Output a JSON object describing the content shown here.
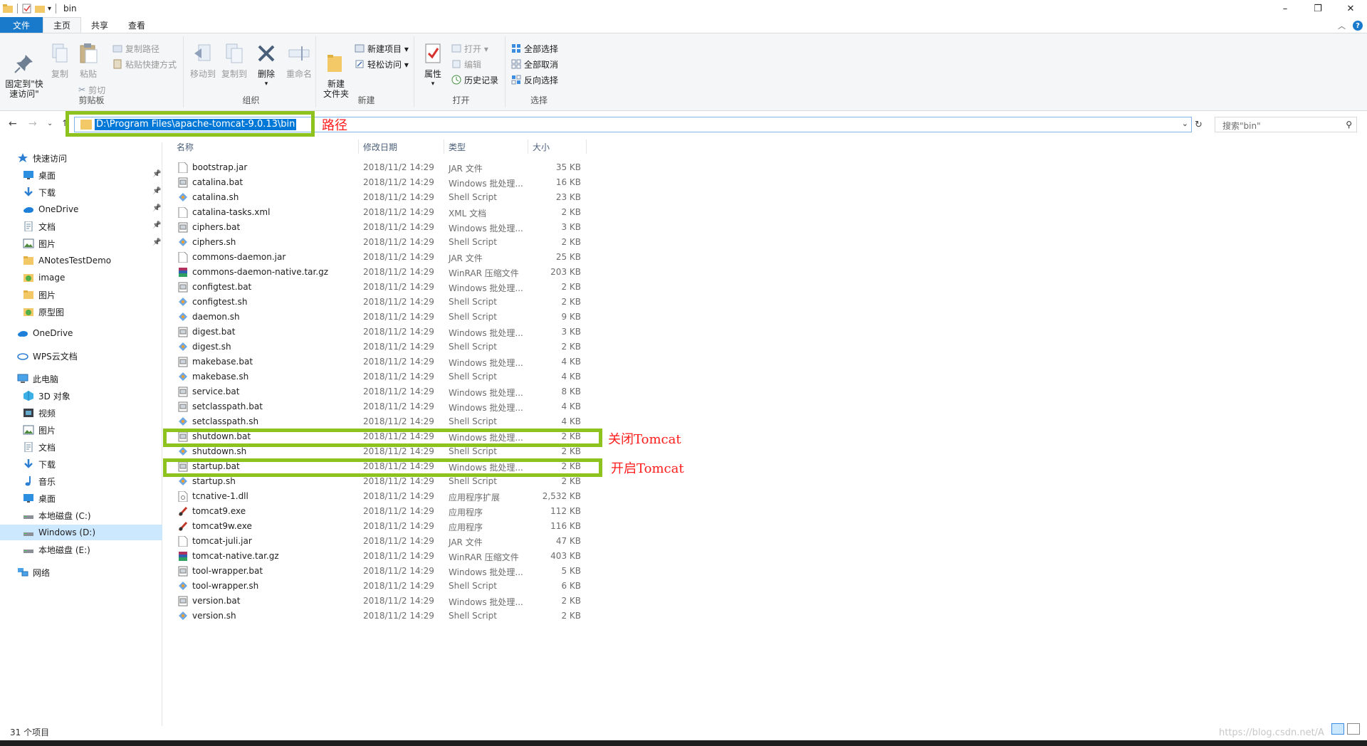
{
  "window": {
    "title": "bin",
    "controls": [
      "–",
      "❐",
      "✕"
    ]
  },
  "ribbon_tabs": [
    "文件",
    "主页",
    "共享",
    "查看"
  ],
  "ribbon": {
    "clipboard": {
      "label": "剪贴板",
      "pin": "固定到\"快\n速访问\"",
      "copy": "复制",
      "paste": "粘贴",
      "copy_path": "复制路径",
      "paste_shortcut": "粘贴快捷方式",
      "cut": "剪切"
    },
    "organize": {
      "label": "组织",
      "move_to": "移动到",
      "copy_to": "复制到",
      "delete": "删除",
      "rename": "重命名"
    },
    "new": {
      "label": "新建",
      "new_folder": "新建\n文件夹",
      "new_item": "新建项目 ▾",
      "easy_access": "轻松访问 ▾"
    },
    "open": {
      "label": "打开",
      "properties": "属性",
      "open": "打开 ▾",
      "edit": "编辑",
      "history": "历史记录"
    },
    "select": {
      "label": "选择",
      "select_all": "全部选择",
      "select_none": "全部取消",
      "invert": "反向选择"
    }
  },
  "address": {
    "path": "D:\\Program Files\\apache-tomcat-9.0.13\\bin",
    "search_placeholder": "搜索\"bin\""
  },
  "annotations": {
    "path": "路径",
    "shutdown": "关闭Tomcat",
    "startup": "开启Tomcat"
  },
  "nav_pane": [
    {
      "label": "快速访问",
      "icon": "star-icon",
      "level": 0
    },
    {
      "label": "桌面",
      "icon": "desktop-icon",
      "level": 1,
      "pinned": true
    },
    {
      "label": "下载",
      "icon": "download-icon",
      "level": 1,
      "pinned": true
    },
    {
      "label": "OneDrive",
      "icon": "cloud-icon",
      "level": 1,
      "pinned": true
    },
    {
      "label": "文档",
      "icon": "document-icon",
      "level": 1,
      "pinned": true
    },
    {
      "label": "图片",
      "icon": "picture-icon",
      "level": 1,
      "pinned": true
    },
    {
      "label": "ANotesTestDemo",
      "icon": "folder-icon",
      "level": 1
    },
    {
      "label": "image",
      "icon": "folder-image-icon",
      "level": 1
    },
    {
      "label": "图片",
      "icon": "folder-icon",
      "level": 1
    },
    {
      "label": "原型图",
      "icon": "folder-image-icon",
      "level": 1
    },
    {
      "label": "OneDrive",
      "icon": "cloud-icon",
      "level": 0
    },
    {
      "label": "WPS云文档",
      "icon": "wps-cloud-icon",
      "level": 0
    },
    {
      "label": "此电脑",
      "icon": "pc-icon",
      "level": 0
    },
    {
      "label": "3D 对象",
      "icon": "3d-icon",
      "level": 1
    },
    {
      "label": "视频",
      "icon": "video-icon",
      "level": 1
    },
    {
      "label": "图片",
      "icon": "picture-icon",
      "level": 1
    },
    {
      "label": "文档",
      "icon": "document-icon",
      "level": 1
    },
    {
      "label": "下载",
      "icon": "download-icon",
      "level": 1
    },
    {
      "label": "音乐",
      "icon": "music-icon",
      "level": 1
    },
    {
      "label": "桌面",
      "icon": "desktop-icon",
      "level": 1
    },
    {
      "label": "本地磁盘 (C:)",
      "icon": "drive-icon",
      "level": 1
    },
    {
      "label": "Windows (D:)",
      "icon": "drive-icon",
      "level": 1,
      "selected": true
    },
    {
      "label": "本地磁盘 (E:)",
      "icon": "drive-icon",
      "level": 1
    },
    {
      "label": "网络",
      "icon": "network-icon",
      "level": 0
    }
  ],
  "columns": [
    "名称",
    "修改日期",
    "类型",
    "大小"
  ],
  "files": [
    {
      "name": "bootstrap.jar",
      "date": "2018/11/2 14:29",
      "type": "JAR 文件",
      "size": "35 KB",
      "icon": "jar"
    },
    {
      "name": "catalina.bat",
      "date": "2018/11/2 14:29",
      "type": "Windows 批处理...",
      "size": "16 KB",
      "icon": "bat"
    },
    {
      "name": "catalina.sh",
      "date": "2018/11/2 14:29",
      "type": "Shell Script",
      "size": "23 KB",
      "icon": "sh"
    },
    {
      "name": "catalina-tasks.xml",
      "date": "2018/11/2 14:29",
      "type": "XML 文档",
      "size": "2 KB",
      "icon": "jar"
    },
    {
      "name": "ciphers.bat",
      "date": "2018/11/2 14:29",
      "type": "Windows 批处理...",
      "size": "3 KB",
      "icon": "bat"
    },
    {
      "name": "ciphers.sh",
      "date": "2018/11/2 14:29",
      "type": "Shell Script",
      "size": "2 KB",
      "icon": "sh"
    },
    {
      "name": "commons-daemon.jar",
      "date": "2018/11/2 14:29",
      "type": "JAR 文件",
      "size": "25 KB",
      "icon": "jar"
    },
    {
      "name": "commons-daemon-native.tar.gz",
      "date": "2018/11/2 14:29",
      "type": "WinRAR 压缩文件",
      "size": "203 KB",
      "icon": "rar"
    },
    {
      "name": "configtest.bat",
      "date": "2018/11/2 14:29",
      "type": "Windows 批处理...",
      "size": "2 KB",
      "icon": "bat"
    },
    {
      "name": "configtest.sh",
      "date": "2018/11/2 14:29",
      "type": "Shell Script",
      "size": "2 KB",
      "icon": "sh"
    },
    {
      "name": "daemon.sh",
      "date": "2018/11/2 14:29",
      "type": "Shell Script",
      "size": "9 KB",
      "icon": "sh"
    },
    {
      "name": "digest.bat",
      "date": "2018/11/2 14:29",
      "type": "Windows 批处理...",
      "size": "3 KB",
      "icon": "bat"
    },
    {
      "name": "digest.sh",
      "date": "2018/11/2 14:29",
      "type": "Shell Script",
      "size": "2 KB",
      "icon": "sh"
    },
    {
      "name": "makebase.bat",
      "date": "2018/11/2 14:29",
      "type": "Windows 批处理...",
      "size": "4 KB",
      "icon": "bat"
    },
    {
      "name": "makebase.sh",
      "date": "2018/11/2 14:29",
      "type": "Shell Script",
      "size": "4 KB",
      "icon": "sh"
    },
    {
      "name": "service.bat",
      "date": "2018/11/2 14:29",
      "type": "Windows 批处理...",
      "size": "8 KB",
      "icon": "bat"
    },
    {
      "name": "setclasspath.bat",
      "date": "2018/11/2 14:29",
      "type": "Windows 批处理...",
      "size": "4 KB",
      "icon": "bat"
    },
    {
      "name": "setclasspath.sh",
      "date": "2018/11/2 14:29",
      "type": "Shell Script",
      "size": "4 KB",
      "icon": "sh"
    },
    {
      "name": "shutdown.bat",
      "date": "2018/11/2 14:29",
      "type": "Windows 批处理...",
      "size": "2 KB",
      "icon": "bat"
    },
    {
      "name": "shutdown.sh",
      "date": "2018/11/2 14:29",
      "type": "Shell Script",
      "size": "2 KB",
      "icon": "sh"
    },
    {
      "name": "startup.bat",
      "date": "2018/11/2 14:29",
      "type": "Windows 批处理...",
      "size": "2 KB",
      "icon": "bat"
    },
    {
      "name": "startup.sh",
      "date": "2018/11/2 14:29",
      "type": "Shell Script",
      "size": "2 KB",
      "icon": "sh"
    },
    {
      "name": "tcnative-1.dll",
      "date": "2018/11/2 14:29",
      "type": "应用程序扩展",
      "size": "2,532 KB",
      "icon": "dll"
    },
    {
      "name": "tomcat9.exe",
      "date": "2018/11/2 14:29",
      "type": "应用程序",
      "size": "112 KB",
      "icon": "exe"
    },
    {
      "name": "tomcat9w.exe",
      "date": "2018/11/2 14:29",
      "type": "应用程序",
      "size": "116 KB",
      "icon": "exe"
    },
    {
      "name": "tomcat-juli.jar",
      "date": "2018/11/2 14:29",
      "type": "JAR 文件",
      "size": "47 KB",
      "icon": "jar"
    },
    {
      "name": "tomcat-native.tar.gz",
      "date": "2018/11/2 14:29",
      "type": "WinRAR 压缩文件",
      "size": "403 KB",
      "icon": "rar"
    },
    {
      "name": "tool-wrapper.bat",
      "date": "2018/11/2 14:29",
      "type": "Windows 批处理...",
      "size": "5 KB",
      "icon": "bat"
    },
    {
      "name": "tool-wrapper.sh",
      "date": "2018/11/2 14:29",
      "type": "Shell Script",
      "size": "6 KB",
      "icon": "sh"
    },
    {
      "name": "version.bat",
      "date": "2018/11/2 14:29",
      "type": "Windows 批处理...",
      "size": "2 KB",
      "icon": "bat"
    },
    {
      "name": "version.sh",
      "date": "2018/11/2 14:29",
      "type": "Shell Script",
      "size": "2 KB",
      "icon": "sh"
    }
  ],
  "status": {
    "item_count": "31 个项目",
    "watermark": "https://blog.csdn.net/A"
  },
  "colors": {
    "accent": "#1979ca",
    "highlight_green": "#8ec31f",
    "annotation_red": "#ff1c1c",
    "selection": "#0078d7"
  }
}
